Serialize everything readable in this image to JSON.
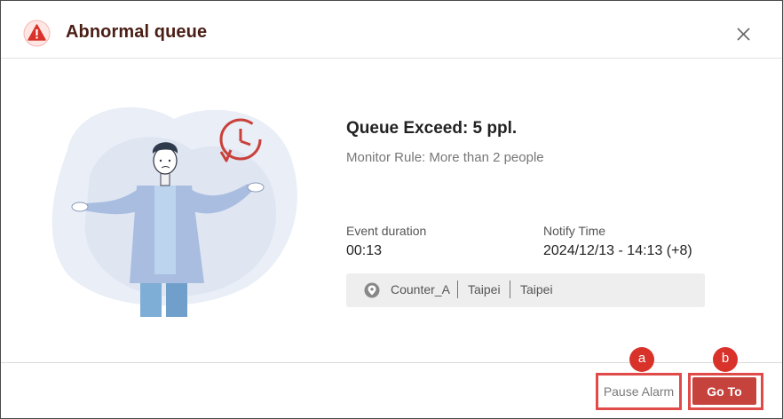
{
  "dialog": {
    "title": "Abnormal queue",
    "icon": "warning-triangle-icon",
    "alert_color": "#d8322b"
  },
  "info": {
    "heading": "Queue Exceed: 5 ppl.",
    "subtitle": "Monitor Rule: More than 2 people",
    "event_duration_label": "Event duration",
    "event_duration_value": "00:13",
    "notify_time_label": "Notify Time",
    "notify_time_value": "2024/12/13 - 14:13 (+8)"
  },
  "location": {
    "icon": "location-pin-icon",
    "parts": [
      "Counter_A",
      "Taipei",
      "Taipei"
    ]
  },
  "footer": {
    "pause_label": "Pause Alarm",
    "goto_label": "Go To",
    "accent_color": "#c6433d"
  },
  "annotations": {
    "a": "a",
    "b": "b"
  }
}
